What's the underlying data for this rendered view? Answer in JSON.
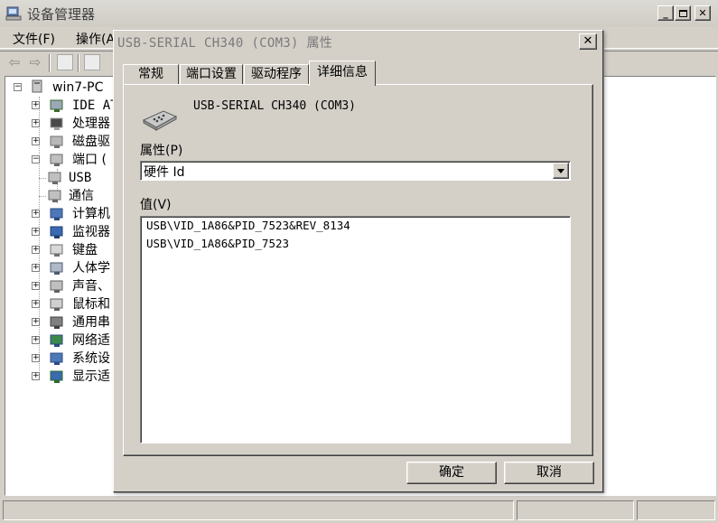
{
  "main_window": {
    "title": "设备管理器",
    "menu": [
      "文件(F)",
      "操作(A"
    ],
    "tree": {
      "root": "win7-PC",
      "items": [
        {
          "label": "IDE AT",
          "icon": "ide-controller-icon",
          "expanded": false
        },
        {
          "label": "处理器",
          "icon": "processor-icon",
          "expanded": false
        },
        {
          "label": "磁盘驱",
          "icon": "disk-drive-icon",
          "expanded": false
        },
        {
          "label": "端口 (",
          "icon": "port-icon",
          "expanded": true
        },
        {
          "label": "USB",
          "icon": "usb-serial-port-icon",
          "child": true
        },
        {
          "label": "通信",
          "icon": "communication-port-icon",
          "child": true
        },
        {
          "label": "计算机",
          "icon": "computer-icon",
          "expanded": false
        },
        {
          "label": "监视器",
          "icon": "monitor-icon",
          "expanded": false
        },
        {
          "label": "键盘",
          "icon": "keyboard-icon",
          "expanded": false
        },
        {
          "label": "人体学",
          "icon": "hid-icon",
          "expanded": false
        },
        {
          "label": "声音、",
          "icon": "sound-icon",
          "expanded": false
        },
        {
          "label": "鼠标和",
          "icon": "mouse-icon",
          "expanded": false
        },
        {
          "label": "通用串",
          "icon": "usb-controller-icon",
          "expanded": false
        },
        {
          "label": "网络适",
          "icon": "network-adapter-icon",
          "expanded": false
        },
        {
          "label": "系统设",
          "icon": "system-device-icon",
          "expanded": false
        },
        {
          "label": "显示适",
          "icon": "display-adapter-icon",
          "expanded": false
        }
      ]
    }
  },
  "dialog": {
    "title": "USB-SERIAL CH340 (COM3) 属性",
    "tabs": [
      "常规",
      "端口设置",
      "驱动程序",
      "详细信息"
    ],
    "active_tab": "详细信息",
    "device_name": "USB-SERIAL CH340 (COM3)",
    "property_label": "属性(P)",
    "property_value": "硬件 Id",
    "value_label": "值(V)",
    "values": [
      "USB\\VID_1A86&PID_7523&REV_8134",
      "USB\\VID_1A86&PID_7523"
    ],
    "ok_label": "确定",
    "cancel_label": "取消"
  },
  "colors": {
    "face": "#d4d0c8",
    "shadow": "#808080",
    "highlight": "#ffffff",
    "title_text_inactive": "#7a7a7a"
  }
}
